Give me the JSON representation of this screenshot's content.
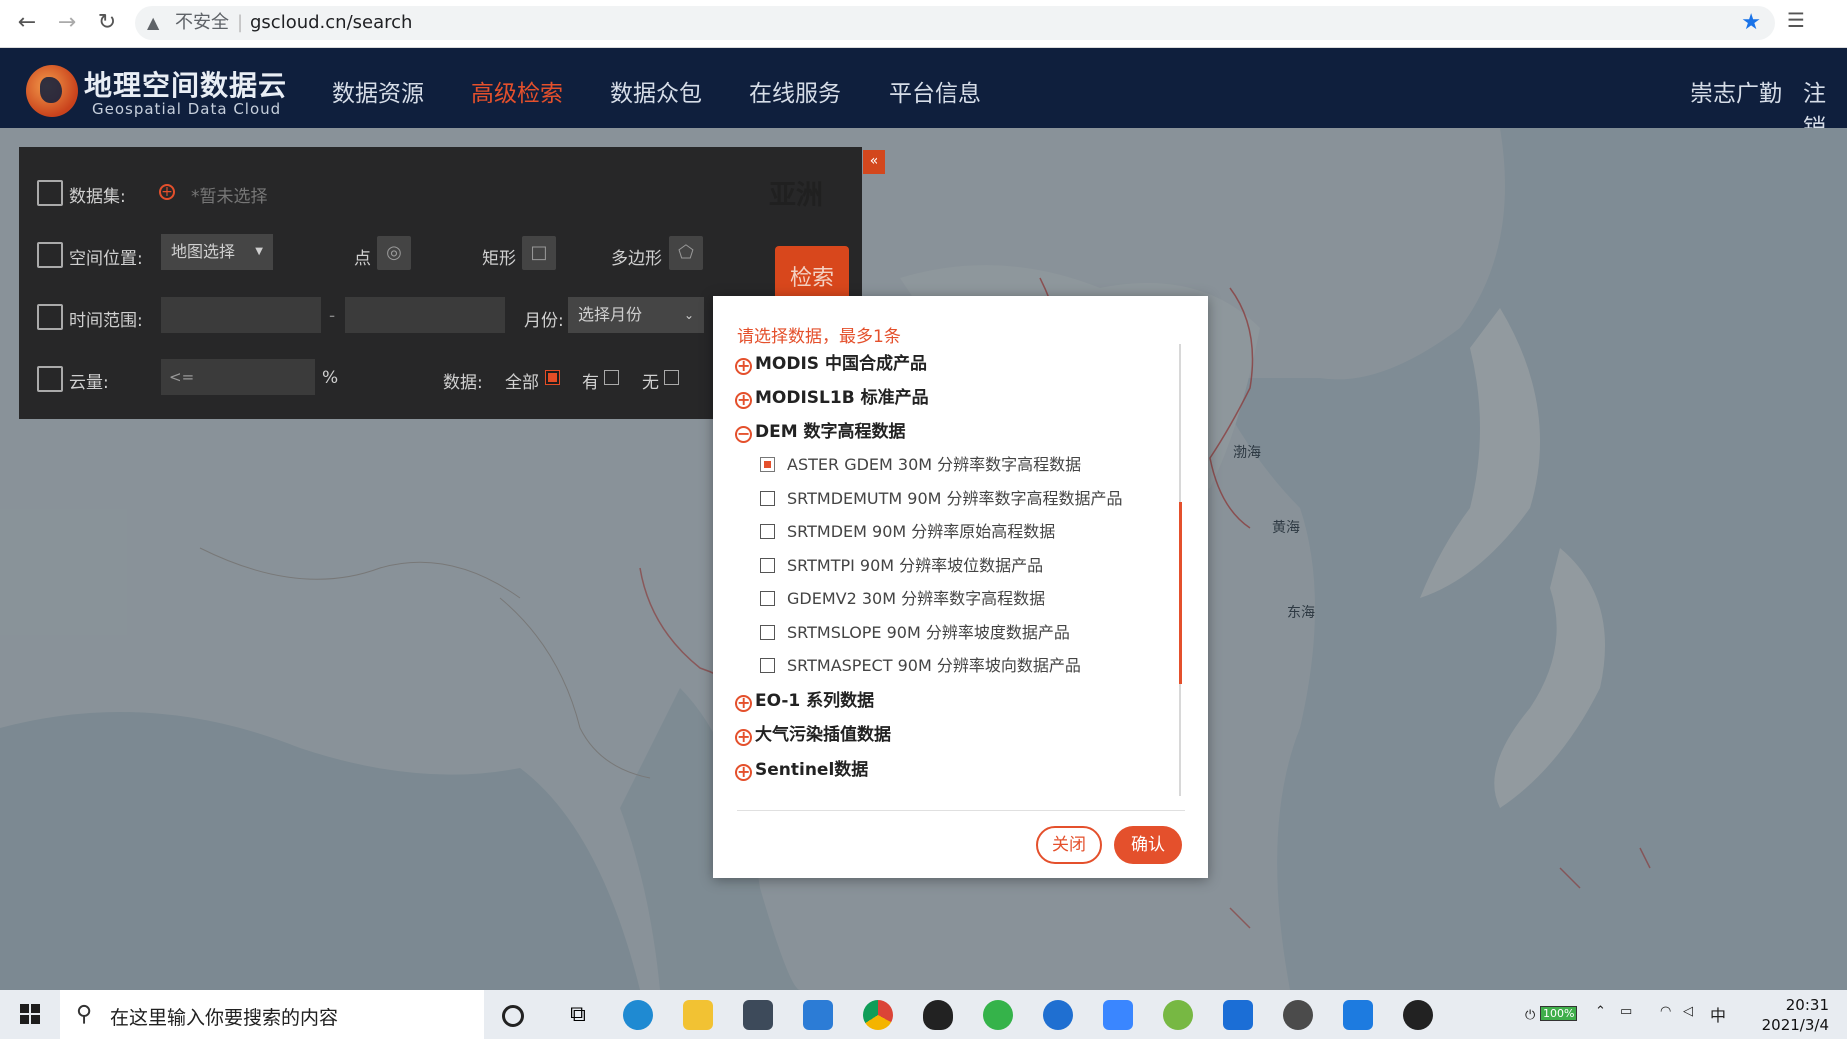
{
  "browser": {
    "insecure_label": "不安全",
    "url": "gscloud.cn/search"
  },
  "site": {
    "logo_cn": "地理空间数据云",
    "logo_en": "Geospatial Data Cloud",
    "nav": [
      "数据资源",
      "高级检索",
      "数据众包",
      "在线服务",
      "平台信息"
    ],
    "active_nav": "高级检索",
    "user": "崇志广勤",
    "logout": "注销"
  },
  "search_panel": {
    "dataset_label": "数据集:",
    "dataset_value": "*暂未选择",
    "location_label": "空间位置:",
    "location_select": "地图选择",
    "point_label": "点",
    "rect_label": "矩形",
    "polygon_label": "多边形",
    "time_label": "时间范围:",
    "time_sep": "-",
    "month_label": "月份:",
    "month_placeholder": "选择月份",
    "cloud_label": "云量:",
    "cloud_placeholder": "<=",
    "cloud_unit": "%",
    "data_label": "数据:",
    "opt_all": "全部",
    "opt_yes": "有",
    "opt_no": "无",
    "region": "亚洲",
    "search_button": "检索",
    "collapse": "«"
  },
  "dialog": {
    "hint": "请选择数据，最多1条",
    "categories": [
      {
        "label": "MODIS 中国合成产品",
        "toggle": "+"
      },
      {
        "label": "MODISL1B 标准产品",
        "toggle": "+"
      },
      {
        "label": "DEM 数字高程数据",
        "toggle": "−"
      },
      {
        "label": "EO-1 系列数据",
        "toggle": "+"
      },
      {
        "label": "大气污染插值数据",
        "toggle": "+"
      },
      {
        "label": "Sentinel数据",
        "toggle": "+"
      }
    ],
    "dem_items": [
      {
        "label": "ASTER GDEM 30M 分辨率数字高程数据",
        "checked": true
      },
      {
        "label": "SRTMDEMUTM 90M 分辨率数字高程数据产品",
        "checked": false
      },
      {
        "label": "SRTMDEM 90M 分辨率原始高程数据",
        "checked": false
      },
      {
        "label": "SRTMTPI 90M 分辨率坡位数据产品",
        "checked": false
      },
      {
        "label": "GDEMV2 30M 分辨率数字高程数据",
        "checked": false
      },
      {
        "label": "SRTMSLOPE 90M 分辨率坡度数据产品",
        "checked": false
      },
      {
        "label": "SRTMASPECT 90M 分辨率坡向数据产品",
        "checked": false
      }
    ],
    "close_button": "关闭",
    "confirm_button": "确认"
  },
  "map": {
    "labels": [
      "渤海",
      "黄海",
      "东海"
    ]
  },
  "taskbar": {
    "search_placeholder": "在这里输入你要搜索的内容",
    "battery": "100%",
    "ime": "中",
    "time": "20:31",
    "date": "2021/3/4"
  }
}
